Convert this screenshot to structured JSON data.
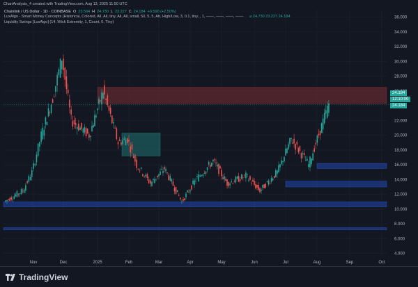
{
  "header": {
    "caption": "ChartAnalysis_4 created with TradingView.com, Aug 13, 2025 11:50 UTC"
  },
  "legend": {
    "symbol": "Chainlink / US Dollar · 1D · COINBASE",
    "o_label": "O",
    "o_value": "23.594",
    "h_label": "H",
    "h_value": "24.730",
    "l_label": "L",
    "l_value": "23.227",
    "c_label": "C",
    "c_value": "24.184",
    "change": "+0.590 (+2.50%)",
    "indicator1": "LuxAlgo - Smart Money Concepts (Historical, Colored, All, All, tiny, All, All, small, 50, 5, 5, Atr, High/Low, 3, 0.1, tiny, , 1, ——, ——, ——, ——",
    "indicator1_values": "⌀ 24.730 23.227 24.184",
    "indicator2": "Liquidity Swings [LuxAlgo] (14, Wick Extremity, 1, Count, 0, Tiny)"
  },
  "price_tags": {
    "last": "24.184",
    "countdown": "12:10:00",
    "last2": "24.184"
  },
  "brand": {
    "name": "TradingView"
  },
  "colors": {
    "background": "#131722",
    "up": "#26a69a",
    "down": "#ef5350",
    "grid": "#1e222d",
    "supply_zone": "#b2383b",
    "demand_zone": "#2962ff",
    "ob_green": "#26a69a"
  },
  "chart_data": {
    "type": "candlestick",
    "title": "",
    "xlabel": "",
    "ylabel": "",
    "y_axis_ticks": [
      "4.000",
      "6.000",
      "8.000",
      "10.000",
      "12.000",
      "14.000",
      "16.000",
      "18.000",
      "20.000",
      "22.000",
      "24.000",
      "26.000",
      "28.000",
      "30.000",
      "32.000",
      "34.000",
      "36.000"
    ],
    "x_axis_ticks": [
      "Nov",
      "Dec",
      "2025",
      "Feb",
      "Mar",
      "Apr",
      "May",
      "Jun",
      "Jul",
      "Aug",
      "Sep",
      "Oct"
    ],
    "ylim": [
      3.5,
      37
    ],
    "grid": true,
    "price_path": [
      {
        "date": "Oct",
        "price": 11
      },
      {
        "date": "Nov",
        "price": 12.5
      },
      {
        "date": "Nov",
        "price": 15
      },
      {
        "date": "Nov",
        "price": 20
      },
      {
        "date": "Dec",
        "price": 25
      },
      {
        "date": "Dec",
        "price": 30.5
      },
      {
        "date": "Dec",
        "price": 22
      },
      {
        "date": "2025",
        "price": 20
      },
      {
        "date": "2025",
        "price": 26
      },
      {
        "date": "Feb",
        "price": 19
      },
      {
        "date": "Feb",
        "price": 19.5
      },
      {
        "date": "Feb",
        "price": 16
      },
      {
        "date": "Mar",
        "price": 13.5
      },
      {
        "date": "Mar",
        "price": 15.5
      },
      {
        "date": "Apr",
        "price": 11
      },
      {
        "date": "Apr",
        "price": 14
      },
      {
        "date": "May",
        "price": 16.5
      },
      {
        "date": "May",
        "price": 13.5
      },
      {
        "date": "Jun",
        "price": 14.5
      },
      {
        "date": "Jun",
        "price": 12.5
      },
      {
        "date": "Jul",
        "price": 15
      },
      {
        "date": "Jul",
        "price": 19.5
      },
      {
        "date": "Aug",
        "price": 16
      },
      {
        "date": "Aug",
        "price": 24.2
      }
    ],
    "zones": [
      {
        "label": "Supply zone",
        "from": "2025",
        "to": "Sep",
        "y_top": 26.5,
        "y_bottom": 24.3,
        "color": "#b2383b"
      },
      {
        "label": "Demand zone (Aug)",
        "from": "Aug",
        "to": "Sep",
        "y_top": 16.2,
        "y_bottom": 15.5,
        "color": "#2962ff"
      },
      {
        "label": "Demand zone (Jul)",
        "from": "Jul",
        "to": "Sep",
        "y_top": 13.8,
        "y_bottom": 13.0,
        "color": "#2962ff"
      },
      {
        "label": "Demand zone (Oct–Sep)",
        "from": "Oct",
        "to": "Sep",
        "y_top": 11.0,
        "y_bottom": 10.3,
        "color": "#2962ff"
      },
      {
        "label": "Demand zone (low)",
        "from": "Oct",
        "to": "Sep",
        "y_top": 7.5,
        "y_bottom": 7.2,
        "color": "#2962ff"
      },
      {
        "label": "Order block",
        "from": "Feb",
        "to": "Feb",
        "y_top": 20.3,
        "y_bottom": 17.2,
        "color": "#26a69a"
      }
    ]
  }
}
